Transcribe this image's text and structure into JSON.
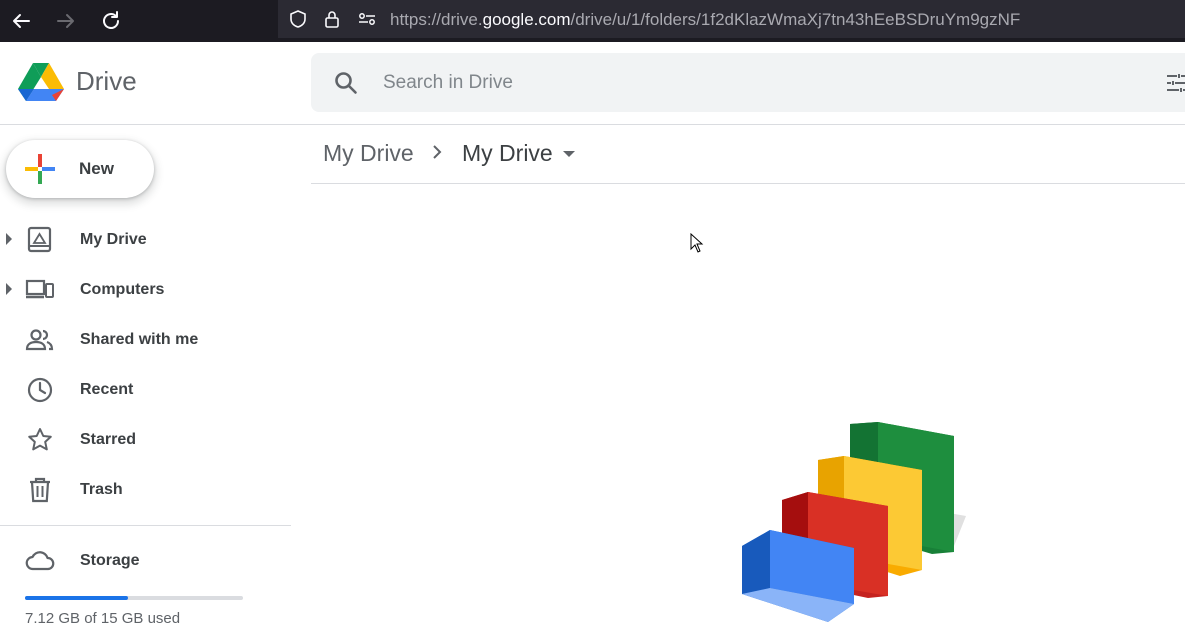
{
  "browser": {
    "url_prefix": "https://drive.",
    "url_host": "google.com",
    "url_path": "/drive/u/1/folders/1f2dKlazWmaXj7tn43hEeBSDruYm9gzNF"
  },
  "app": {
    "name": "Drive",
    "search_placeholder": "Search in Drive"
  },
  "sidebar": {
    "new_label": "New",
    "items": [
      {
        "label": "My Drive",
        "icon": "my-drive-icon"
      },
      {
        "label": "Computers",
        "icon": "computers-icon"
      },
      {
        "label": "Shared with me",
        "icon": "shared-icon"
      },
      {
        "label": "Recent",
        "icon": "clock-icon"
      },
      {
        "label": "Starred",
        "icon": "star-icon"
      },
      {
        "label": "Trash",
        "icon": "trash-icon"
      }
    ],
    "storage_label": "Storage",
    "storage_used_text": "7.12 GB of 15 GB used",
    "storage_fraction": 0.4747
  },
  "breadcrumb": {
    "root": "My Drive",
    "current": "My Drive"
  },
  "colors": {
    "accent": "#1a73e8",
    "google_blue": "#4285f4",
    "google_red": "#ea4335",
    "google_yellow": "#fbbc04",
    "google_green": "#34a853"
  }
}
